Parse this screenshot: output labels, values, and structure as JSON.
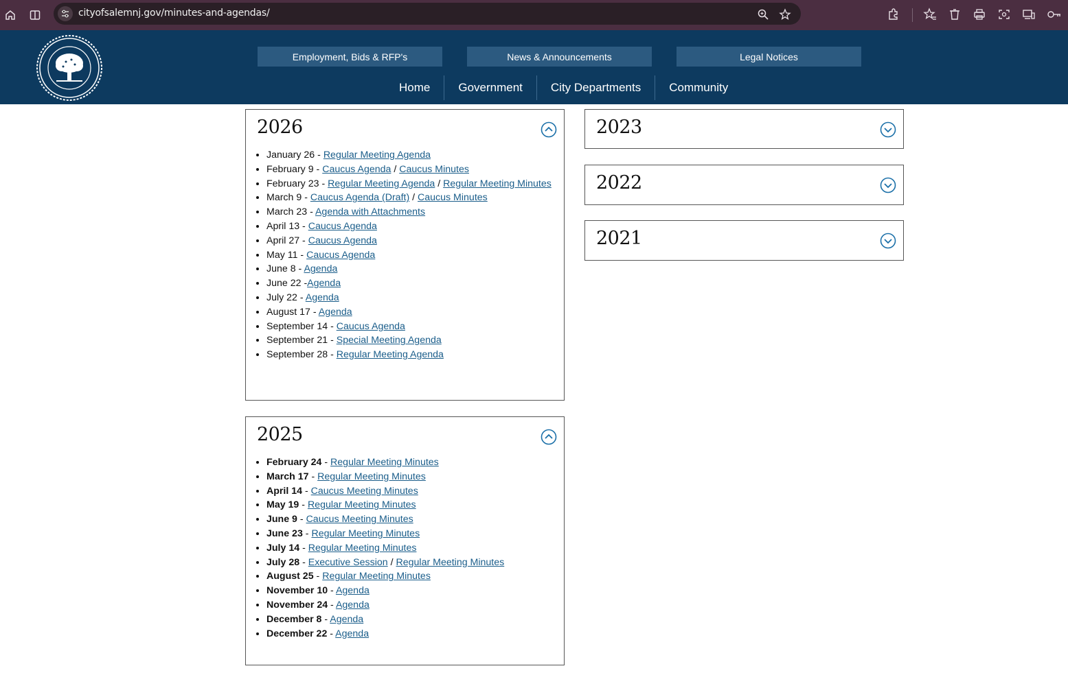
{
  "browser": {
    "url": "cityofsalemnj.gov/minutes-and-agendas/",
    "icons": [
      "home-icon",
      "split-view-icon",
      "site-info-icon",
      "zoom-icon",
      "bookmark-star-icon",
      "extensions-icon",
      "favorites-icon",
      "delete-icon",
      "print-icon",
      "screenshot-icon",
      "devices-icon",
      "password-key-icon"
    ]
  },
  "header": {
    "top_links": [
      "Employment, Bids & RFP's",
      "News & Announcements",
      "Legal Notices"
    ],
    "nav": [
      "Home",
      "Government",
      "City Departments",
      "Community"
    ],
    "colors": {
      "header_bg": "#0d3a5f",
      "pill_bg": "#2c5a80",
      "link": "#1a5d8a"
    }
  },
  "panels": {
    "y2026": {
      "year": "2026",
      "items": [
        {
          "date": "January 26",
          "sep": " - ",
          "links": [
            "Regular Meeting Agenda"
          ]
        },
        {
          "date": "February 9",
          "sep": " - ",
          "links": [
            "Caucus Agenda",
            "Caucus Minutes"
          ]
        },
        {
          "date": "February 23",
          "sep": " - ",
          "links": [
            "Regular Meeting Agenda",
            "Regular Meeting Minutes"
          ]
        },
        {
          "date": "March 9",
          "sep": " - ",
          "links": [
            "Caucus Agenda (Draft)",
            "Caucus Minutes"
          ]
        },
        {
          "date": "March 23",
          "sep": " - ",
          "links": [
            "Agenda with Attachments"
          ]
        },
        {
          "date": "April 13",
          "sep": " - ",
          "links": [
            "Caucus Agenda"
          ]
        },
        {
          "date": "April 27",
          "sep": " - ",
          "links": [
            "Caucus Agenda"
          ]
        },
        {
          "date": "May 11",
          "sep": " - ",
          "links": [
            "Caucus Agenda"
          ]
        },
        {
          "date": "June 8",
          "sep": " - ",
          "links": [
            "Agenda"
          ]
        },
        {
          "date": "June 22",
          "sep": " -",
          "links": [
            "Agenda"
          ]
        },
        {
          "date": "July 22",
          "sep": " - ",
          "links": [
            "Agenda"
          ]
        },
        {
          "date": "August 17",
          "sep": " - ",
          "links": [
            "Agenda"
          ]
        },
        {
          "date": "September 14",
          "sep": " - ",
          "links": [
            "Caucus Agenda"
          ]
        },
        {
          "date": "September 21",
          "sep": " - ",
          "links": [
            "Special Meeting Agenda"
          ]
        },
        {
          "date": "September 28",
          "sep": " - ",
          "links": [
            "Regular Meeting Agenda"
          ]
        }
      ]
    },
    "y2025": {
      "year": "2025",
      "items": [
        {
          "date": "February 24",
          "sep": " - ",
          "links": [
            "Regular Meeting Minutes"
          ]
        },
        {
          "date": "March 17",
          "sep": " - ",
          "links": [
            "Regular Meeting Minutes"
          ]
        },
        {
          "date": "April 14",
          "sep": " - ",
          "links": [
            "Caucus Meeting Minutes"
          ]
        },
        {
          "date": "May 19",
          "sep": " - ",
          "links": [
            "Regular Meeting Minutes"
          ]
        },
        {
          "date": "June 9",
          "sep": " - ",
          "links": [
            "Caucus Meeting Minutes"
          ]
        },
        {
          "date": "June 23",
          "sep": " - ",
          "links": [
            "Regular Meeting Minutes"
          ]
        },
        {
          "date": "July 14",
          "sep": " - ",
          "links": [
            "Regular Meeting Minutes"
          ]
        },
        {
          "date": "July 28",
          "sep": " - ",
          "links": [
            "Executive Session",
            "Regular Meeting Minutes"
          ]
        },
        {
          "date": "August 25",
          "sep": " - ",
          "links": [
            "Regular Meeting Minutes"
          ]
        },
        {
          "date": "November 10",
          "sep": " - ",
          "links": [
            "Agenda"
          ]
        },
        {
          "date": "November 24",
          "sep": " - ",
          "links": [
            "Agenda"
          ]
        },
        {
          "date": "December 8",
          "sep": " - ",
          "links": [
            "Agenda"
          ]
        },
        {
          "date": "December 22",
          "sep": " - ",
          "links": [
            "Agenda"
          ]
        }
      ]
    },
    "y2023": {
      "year": "2023"
    },
    "y2022": {
      "year": "2022"
    },
    "y2021": {
      "year": "2021"
    }
  }
}
